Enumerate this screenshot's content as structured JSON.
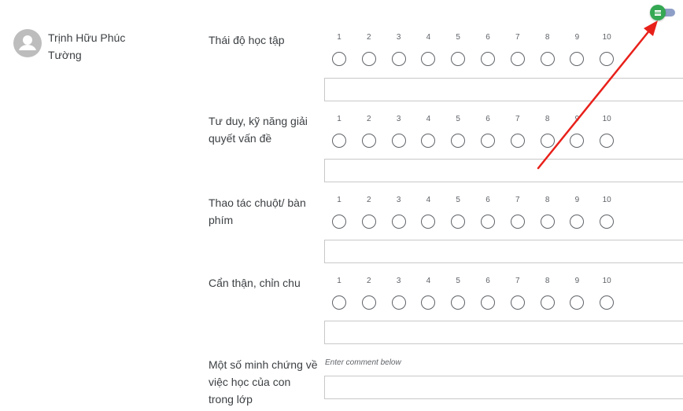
{
  "student": {
    "name": "Trịnh Hữu Phúc Tường",
    "avatar_icon": "person-icon"
  },
  "toggle": {
    "icon": "list-icon",
    "state": "on",
    "color": "#34a853"
  },
  "scale_labels": [
    "1",
    "2",
    "3",
    "4",
    "5",
    "6",
    "7",
    "8",
    "9",
    "10"
  ],
  "criteria": [
    {
      "label": "Thái độ học tập",
      "selected": null
    },
    {
      "label": "Tư duy, kỹ năng giải quyết vấn đề",
      "selected": null
    },
    {
      "label": "Thao tác chuột/ bàn phím",
      "selected": null
    },
    {
      "label": "Cẩn thận, chỉn chu",
      "selected": null
    }
  ],
  "evidence": {
    "label": "Một số minh chứng về việc học của con trong lớp",
    "hint": "Enter comment below"
  },
  "annotation": {
    "type": "red-arrow",
    "color": "#e8201a"
  }
}
